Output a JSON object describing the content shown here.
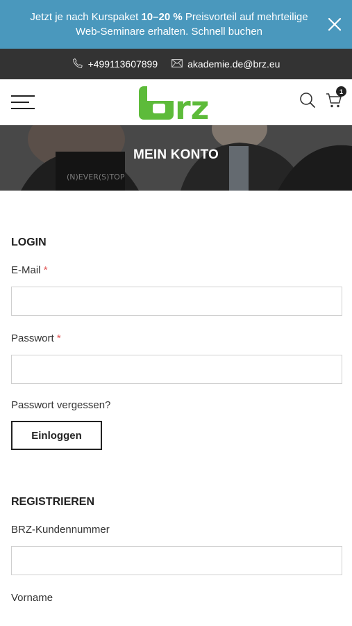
{
  "promo": {
    "text_before": "Jetzt je nach Kurspaket ",
    "text_bold": "10–20 %",
    "text_after": " Preisvorteil auf mehrteilige Web-Seminare erhalten. Schnell buchen"
  },
  "contact": {
    "phone": "+499113607899",
    "email": "akademie.de@brz.eu"
  },
  "header": {
    "logo_text": "brz",
    "cart_count": "1"
  },
  "hero": {
    "title": "MEIN KONTO",
    "board_text": "(N)EVER(S)TOP"
  },
  "login": {
    "title": "LOGIN",
    "email_label": "E-Mail",
    "password_label": "Passwort",
    "required_mark": "*",
    "forgot_link": "Passwort vergessen?",
    "submit_label": "Einloggen"
  },
  "register": {
    "title": "REGISTRIEREN",
    "customer_no_label": "BRZ-Kundennummer",
    "firstname_label": "Vorname"
  },
  "colors": {
    "promo_bg": "#4a98bd",
    "contact_bg": "#333333",
    "brand_green": "#5dbb3a",
    "required": "#e05555"
  }
}
